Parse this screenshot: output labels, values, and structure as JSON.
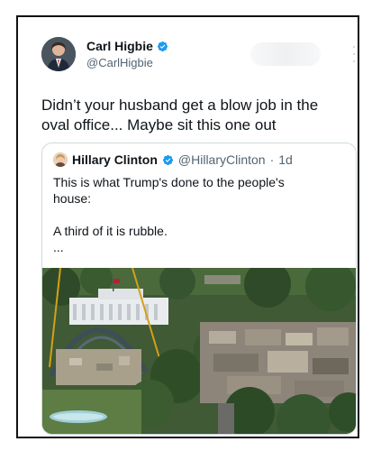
{
  "tweet": {
    "author": {
      "name": "Carl Higbie",
      "handle": "@CarlHigbie"
    },
    "text_line1": "Didn’t your husband get a blow job in the",
    "text_line2": "oval office... Maybe sit this one out"
  },
  "quoted": {
    "author": {
      "name": "Hillary Clinton",
      "handle": "@HillaryClinton",
      "separator": "·",
      "time": "1d"
    },
    "line1": "This is what Trump's done to the people's",
    "line2": "house:",
    "line3": "A third of it is rubble.",
    "ellipsis": "..."
  },
  "colors": {
    "verified": "#1d9bf0",
    "secondary_text": "#536471",
    "border": "#cfd9de"
  },
  "icons": {
    "verified": "verified-badge-icon",
    "more": "more-options-icon"
  }
}
